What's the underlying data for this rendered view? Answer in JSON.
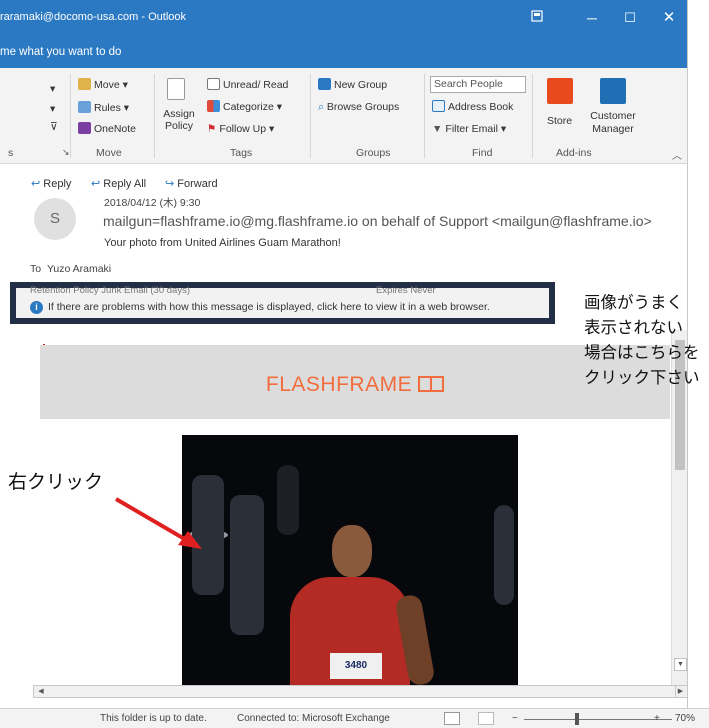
{
  "window": {
    "title": "raramaki@docomo-usa.com - Outlook",
    "tell_me": "me what you want to do",
    "restore_icon": "restore-icon",
    "min_icon": "─",
    "max_icon": "☐",
    "close_icon": "✕"
  },
  "ribbon": {
    "move_group": {
      "move": "Move",
      "rules": "Rules",
      "onenote": "OneNote",
      "label": "Move"
    },
    "tags_group": {
      "assign_policy": "Assign Policy",
      "unread_read": "Unread/ Read",
      "categorize": "Categorize",
      "follow_up": "Follow Up",
      "label": "Tags"
    },
    "groups_group": {
      "new_group": "New Group",
      "browse_groups": "Browse Groups",
      "label": "Groups"
    },
    "find_group": {
      "search_people": "Search People",
      "address_book": "Address Book",
      "filter_email": "Filter Email",
      "label": "Find"
    },
    "addins_group": {
      "store": "Store",
      "customer_manager": "Customer Manager",
      "label": "Add-ins"
    },
    "left_group_suffix": "s"
  },
  "message": {
    "reply": "Reply",
    "reply_all": "Reply All",
    "forward": "Forward",
    "avatar_initial": "S",
    "date": "2018/04/12 (木) 9:30",
    "from": "mailgun=flashframe.io@mg.flashframe.io on behalf of Support <mailgun@flashframe.io>",
    "subject": "Your photo from United Airlines Guam Marathon!",
    "to_label": "To",
    "to": "Yuzo Aramaki",
    "retention": "Retention Policy    Junk Email (30 days)",
    "expires": "Expires    Never",
    "info_text": "If there are problems with how this message is displayed, click here to view it in a web browser."
  },
  "email_body": {
    "brand": "FLASHFRAME",
    "bib_number": "3480"
  },
  "status": {
    "folder_status": "This folder is up to date.",
    "connection": "Connected to: Microsoft Exchange",
    "zoom": "70%",
    "zoom_level": 0.7
  },
  "annotations": {
    "right_click": "右クリック",
    "note_line1": "画像がうまく",
    "note_line2": "表示されない",
    "note_line3": "場合はこちらを",
    "note_line4": "クリック下さい"
  },
  "colors": {
    "title_blue": "#2b79c2",
    "highlight_box": "#232f46",
    "brand_orange": "#f26d3d",
    "arrow_red": "#e02020"
  }
}
